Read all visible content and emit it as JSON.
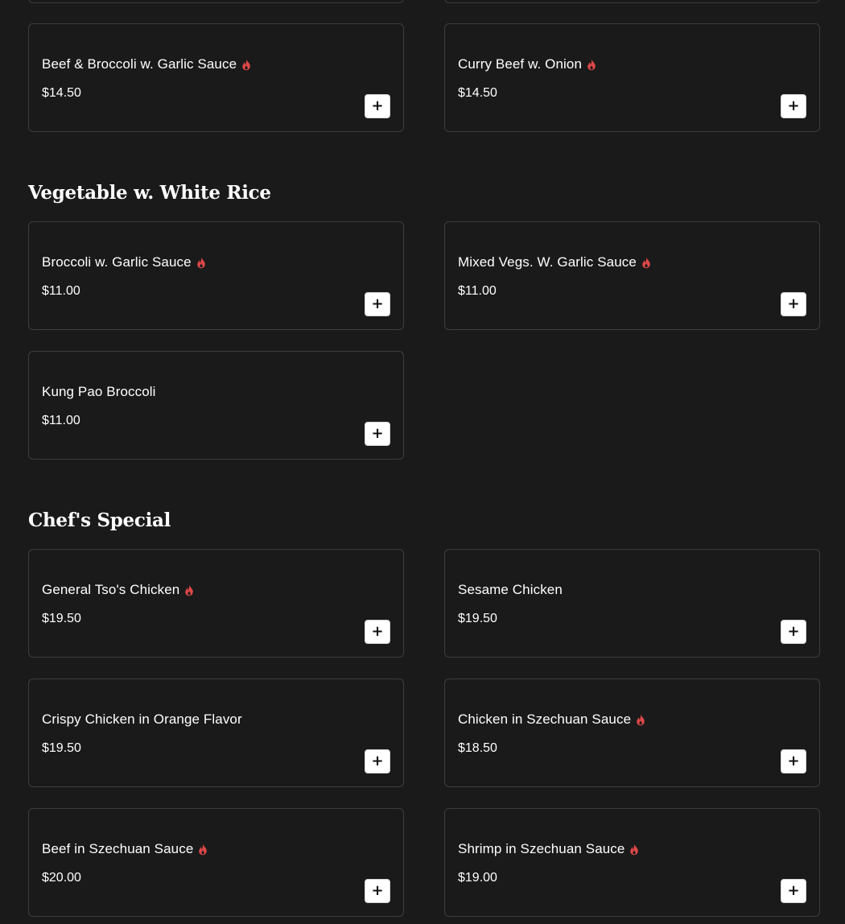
{
  "colors": {
    "background": "#1b1a1b",
    "card_border": "#3e3d3e",
    "spicy_icon": "#e04848",
    "text": "#ffffff"
  },
  "sections": [
    {
      "title": "",
      "items": [
        {
          "name": "Beef & Broccoli w. Garlic Sauce",
          "price": "$14.50",
          "spicy": true
        },
        {
          "name": "Curry Beef w. Onion",
          "price": "$14.50",
          "spicy": true
        }
      ]
    },
    {
      "title": "Vegetable w. White Rice",
      "items": [
        {
          "name": "Broccoli w. Garlic Sauce",
          "price": "$11.00",
          "spicy": true
        },
        {
          "name": "Mixed Vegs. W. Garlic Sauce",
          "price": "$11.00",
          "spicy": true
        },
        {
          "name": "Kung Pao Broccoli",
          "price": "$11.00",
          "spicy": false
        }
      ]
    },
    {
      "title": "Chef's Special",
      "items": [
        {
          "name": "General Tso's Chicken",
          "price": "$19.50",
          "spicy": true
        },
        {
          "name": "Sesame Chicken",
          "price": "$19.50",
          "spicy": false
        },
        {
          "name": "Crispy Chicken in Orange Flavor",
          "price": "$19.50",
          "spicy": false
        },
        {
          "name": "Chicken in Szechuan Sauce",
          "price": "$18.50",
          "spicy": true
        },
        {
          "name": "Beef in Szechuan Sauce",
          "price": "$20.00",
          "spicy": true
        },
        {
          "name": "Shrimp in Szechuan Sauce",
          "price": "$19.00",
          "spicy": true
        }
      ]
    }
  ],
  "icons": {
    "spicy": "flame-icon",
    "add": "plus-icon"
  },
  "add_button_label": "+"
}
